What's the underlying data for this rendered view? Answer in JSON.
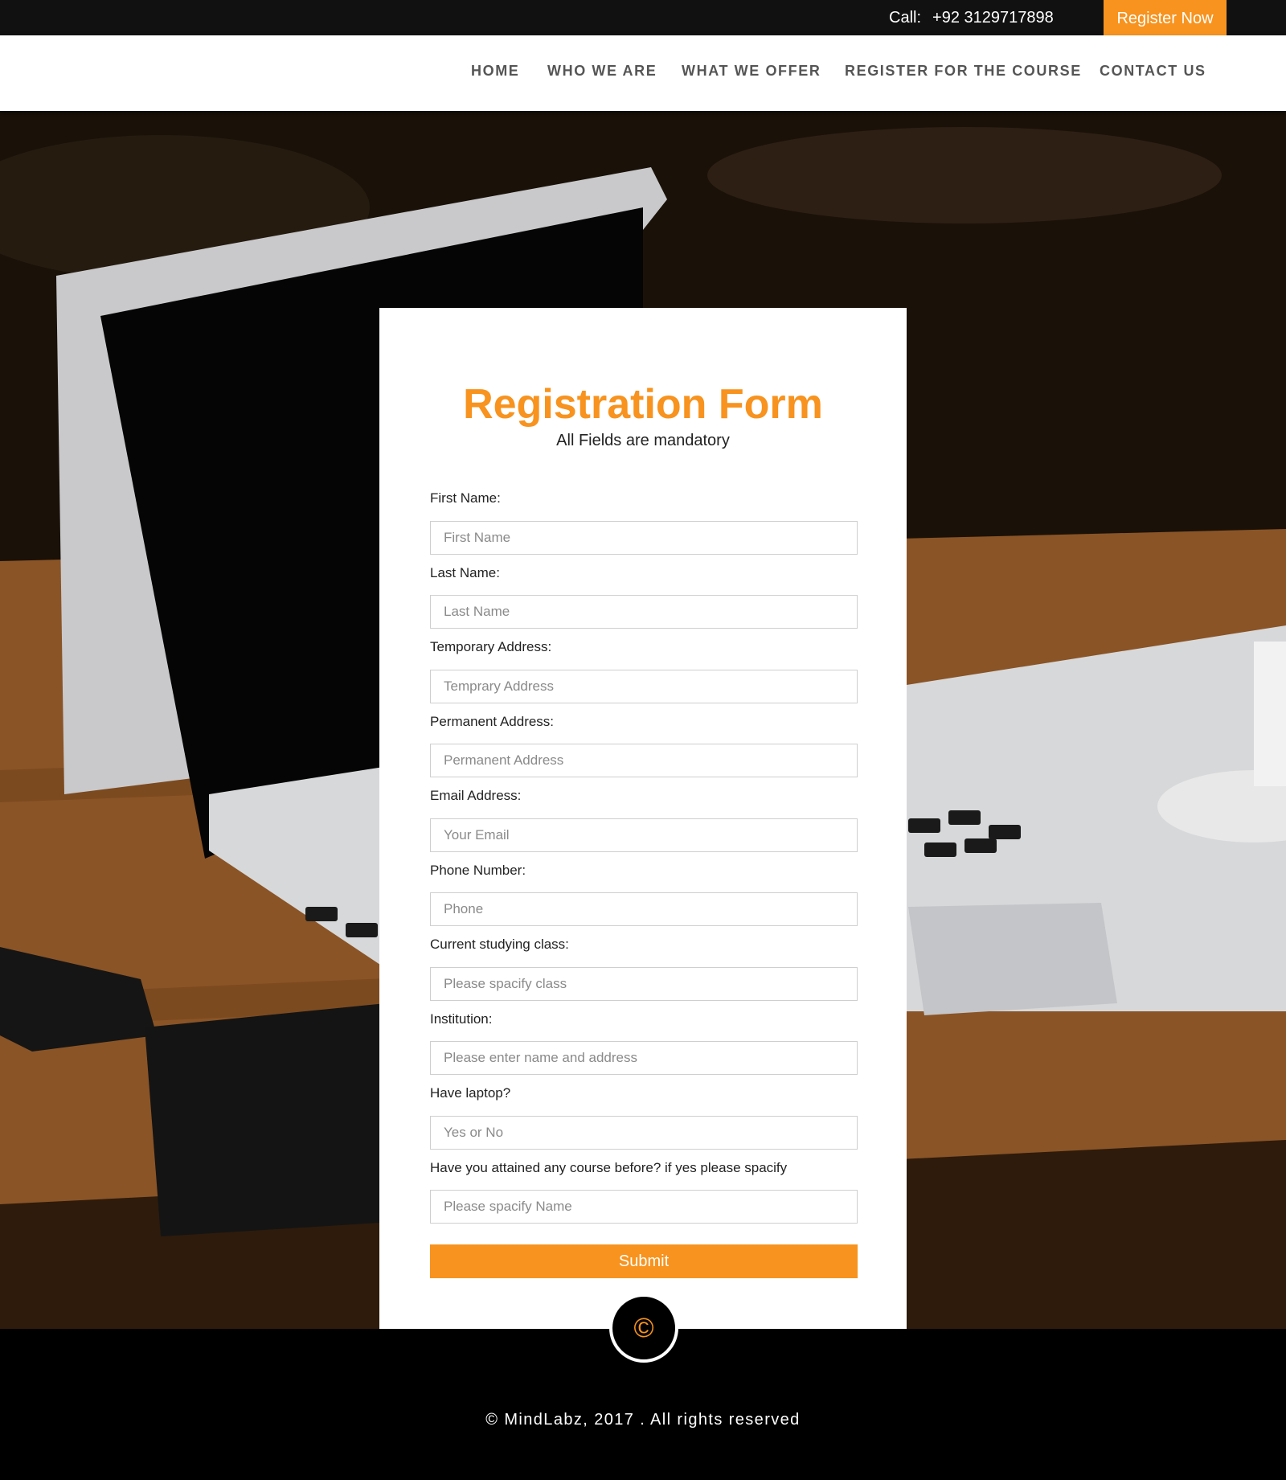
{
  "topbar": {
    "call_label": "Call:",
    "phone": "+92 3129717898",
    "register_label": "Register Now"
  },
  "nav": {
    "items": [
      "HOME",
      "WHO WE ARE",
      "WHAT WE OFFER",
      "REGISTER FOR THE COURSE",
      "CONTACT US"
    ]
  },
  "form": {
    "title": "Registration Form",
    "subtitle": "All Fields are mandatory",
    "fields": [
      {
        "label": "First Name:",
        "placeholder": "First Name"
      },
      {
        "label": "Last Name:",
        "placeholder": "Last Name"
      },
      {
        "label": "Temporary Address:",
        "placeholder": "Temprary Address"
      },
      {
        "label": "Permanent Address:",
        "placeholder": "Permanent Address"
      },
      {
        "label": "Email Address:",
        "placeholder": "Your Email"
      },
      {
        "label": "Phone Number:",
        "placeholder": "Phone"
      },
      {
        "label": "Current studying class:",
        "placeholder": "Please spacify class"
      },
      {
        "label": "Institution:",
        "placeholder": "Please enter name and address"
      },
      {
        "label": "Have laptop?",
        "placeholder": "Yes or No"
      },
      {
        "label": "Have you attained any course before? if yes please spacify",
        "placeholder": "Please spacify Name"
      }
    ],
    "submit_label": "Submit"
  },
  "footer": {
    "badge_icon": "©",
    "text": "© MindLabz, 2017 . All rights reserved"
  },
  "colors": {
    "accent": "#f7931e",
    "topbar_bg": "#111111",
    "footer_bg": "#000000"
  }
}
